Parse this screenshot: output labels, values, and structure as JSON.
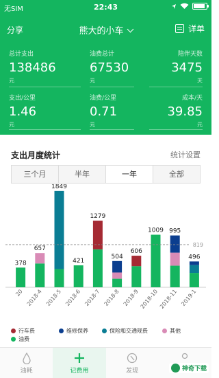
{
  "status": {
    "carrier": "无SIM",
    "time": "22:43"
  },
  "nav": {
    "share": "分享",
    "car_name": "熊大的小车",
    "detail": "详单"
  },
  "stats": [
    {
      "label": "总计支出",
      "value": "138486",
      "unit": "元"
    },
    {
      "label": "油费总计",
      "value": "67530",
      "unit": "元"
    },
    {
      "label": "陪伴天数",
      "value": "3475",
      "unit": "天"
    },
    {
      "label": "支出/公里",
      "value": "1.46",
      "unit": "元"
    },
    {
      "label": "油费/公里",
      "value": "0.71",
      "unit": "元"
    },
    {
      "label": "成本/天",
      "value": "39.85",
      "unit": "元"
    }
  ],
  "card": {
    "title": "支出月度统计",
    "setting": "统计设置",
    "segments": [
      "三个月",
      "半年",
      "一年",
      "全部"
    ],
    "active_segment": "一年"
  },
  "colors": {
    "brand": "#14b55f",
    "driving": "#a52a33",
    "maintenance": "#0b3e8f",
    "insurance": "#0a7d94",
    "other": "#d98bb6",
    "fuel": "#14b55f"
  },
  "chart_data": {
    "type": "bar",
    "stacked": true,
    "categories": [
      "20",
      "2018-4",
      "2018-5",
      "2018-6",
      "2018-7",
      "2018-8",
      "2018-9",
      "2018-10",
      "2018-11",
      "2019-1"
    ],
    "totals": [
      378,
      657,
      1849,
      421,
      1279,
      504,
      606,
      1009,
      995,
      496
    ],
    "series": [
      {
        "name": "油费",
        "key": "fuel",
        "values": [
          378,
          457,
          349,
          421,
          729,
          164,
          406,
          1009,
          415,
          276
        ]
      },
      {
        "name": "其他",
        "key": "other",
        "values": [
          0,
          200,
          0,
          0,
          0,
          120,
          0,
          0,
          250,
          0
        ]
      },
      {
        "name": "保险和交通规费",
        "key": "insurance",
        "values": [
          0,
          0,
          1500,
          0,
          0,
          0,
          0,
          0,
          0,
          150
        ]
      },
      {
        "name": "维修保养",
        "key": "maintenance",
        "values": [
          0,
          0,
          0,
          0,
          0,
          220,
          0,
          0,
          330,
          70
        ]
      },
      {
        "name": "行车费",
        "key": "driving",
        "values": [
          0,
          0,
          0,
          0,
          550,
          0,
          200,
          0,
          0,
          0
        ]
      }
    ],
    "average_line": 819,
    "ylim": [
      0,
      1900
    ],
    "legend_position": "bottom"
  },
  "legend": [
    "行车费",
    "维修保养",
    "保险和交通规费",
    "其他",
    "油费"
  ],
  "tabs": [
    "油耗",
    "记费用",
    "发现",
    ""
  ],
  "active_tab": "记费用",
  "watermark": "神奇下载"
}
